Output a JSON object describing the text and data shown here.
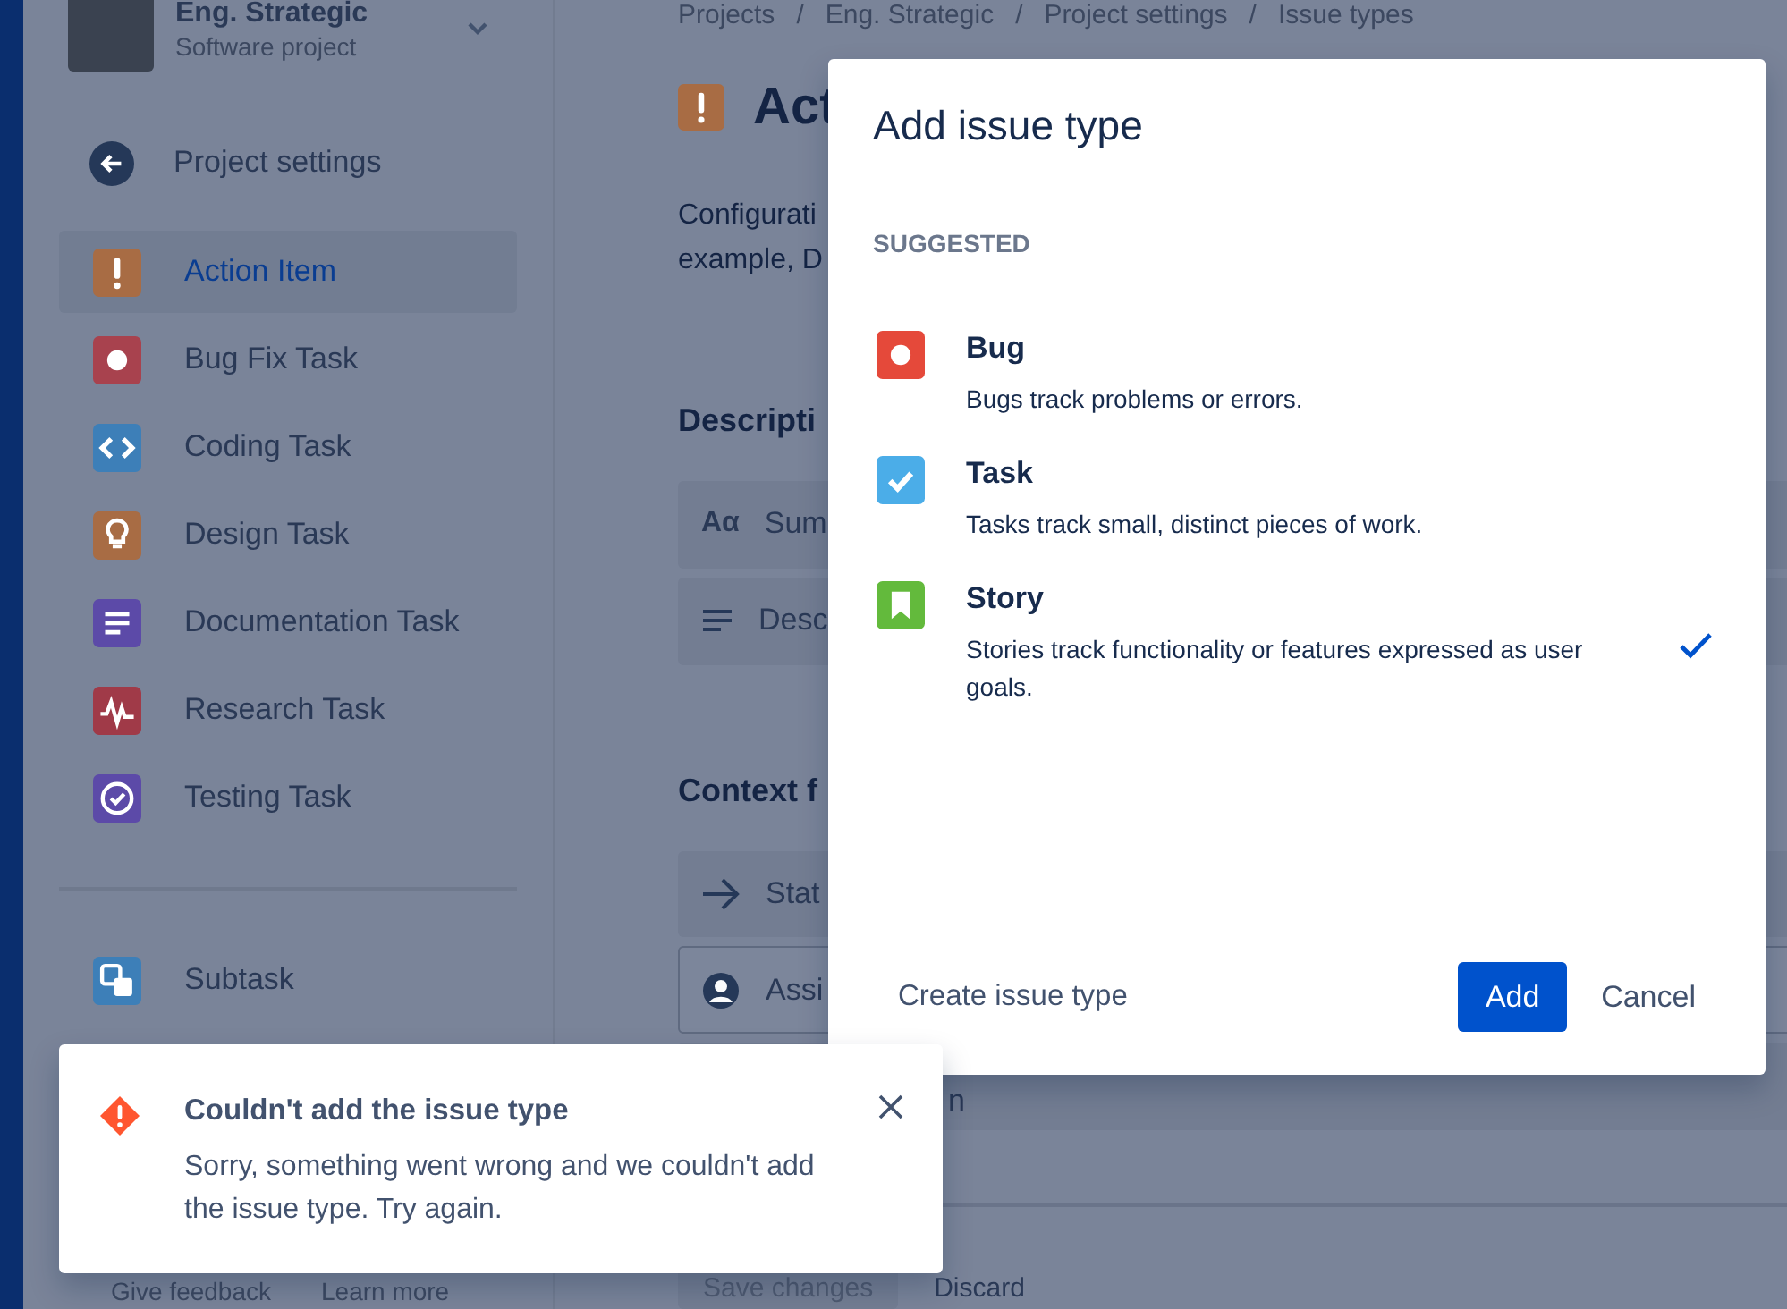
{
  "sidebar": {
    "project_name": "Eng. Strategic",
    "project_type": "Software project",
    "back_link": "Project settings",
    "issue_types": [
      {
        "label": "Action Item",
        "kind": "action",
        "color": "#a86c44",
        "selected": true
      },
      {
        "label": "Bug Fix Task",
        "kind": "bug",
        "color": "#a8424e",
        "selected": false
      },
      {
        "label": "Coding Task",
        "kind": "code",
        "color": "#3d7fb8",
        "selected": false
      },
      {
        "label": "Design Task",
        "kind": "idea",
        "color": "#a86c44",
        "selected": false
      },
      {
        "label": "Documentation Task",
        "kind": "doc",
        "color": "#5c4aa8",
        "selected": false
      },
      {
        "label": "Research Task",
        "kind": "pulse",
        "color": "#a03a48",
        "selected": false
      },
      {
        "label": "Testing Task",
        "kind": "test",
        "color": "#5c4aa8",
        "selected": false
      }
    ],
    "subtasks": [
      {
        "label": "Subtask",
        "kind": "subtask",
        "color": "#3d7fb8",
        "selected": false
      }
    ],
    "footer_links": [
      "Give feedback",
      "Learn more"
    ]
  },
  "breadcrumbs": {
    "separator": "/",
    "items": [
      "Projects",
      "Eng. Strategic",
      "Project settings",
      "Issue types"
    ]
  },
  "page": {
    "title": "Act",
    "description_lines": [
      "Configurati",
      "example, D"
    ],
    "sections": [
      {
        "heading": "Descripti",
        "fields": [
          {
            "kind": "summary",
            "glyph": "Aα",
            "label": "Sum",
            "outlined": false
          },
          {
            "kind": "paragraph",
            "label": "Desc",
            "outlined": false
          }
        ]
      },
      {
        "heading": "Context f",
        "fields": [
          {
            "kind": "status",
            "label": "Stat",
            "outlined": false
          },
          {
            "kind": "person",
            "label": "Assi",
            "outlined": true
          },
          {
            "kind": "plain",
            "label": "n",
            "outlined": false
          }
        ]
      }
    ],
    "actions": [
      "Save changes",
      "Discard"
    ]
  },
  "modal": {
    "title": "Add issue type",
    "section_label": "SUGGESTED",
    "options": [
      {
        "kind": "bug",
        "name": "Bug",
        "description": "Bugs track problems or errors.",
        "color": "#e5493a",
        "selected": false
      },
      {
        "kind": "task",
        "name": "Task",
        "description": "Tasks track small, distinct pieces of work.",
        "color": "#4bade8",
        "selected": false
      },
      {
        "kind": "story",
        "name": "Story",
        "description": "Stories track functionality or features expressed as user goals.",
        "color": "#63ba3c",
        "selected": true
      }
    ],
    "create_link": "Create issue type",
    "primary_button": "Add",
    "cancel_button": "Cancel"
  },
  "flag": {
    "kind": "error",
    "title": "Couldn't add the issue type",
    "message": "Sorry, something went wrong and we couldn't add the issue type. Try again."
  }
}
